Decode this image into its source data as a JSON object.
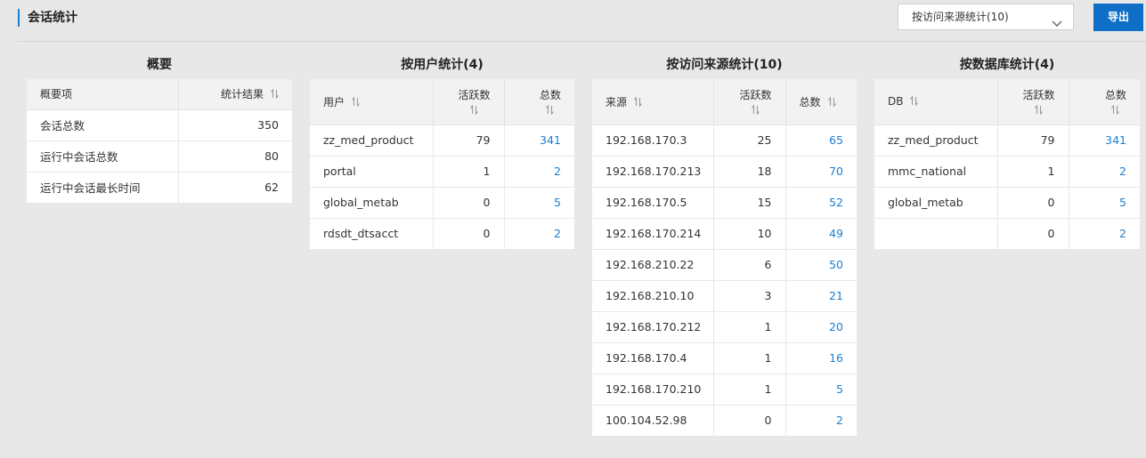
{
  "header": {
    "title": "会话统计",
    "select_value": "按访问来源统计(10)",
    "export_label": "导出"
  },
  "colors": {
    "accent": "#0f6fc6",
    "link": "#1b7fd1"
  },
  "overview": {
    "title": "概要",
    "columns": [
      "概要项",
      "统计结果"
    ],
    "rows": [
      [
        "会话总数",
        "350"
      ],
      [
        "运行中会话总数",
        "80"
      ],
      [
        "运行中会话最长时间",
        "62"
      ]
    ]
  },
  "by_user": {
    "title": "按用户统计(4)",
    "columns": [
      "用户",
      "活跃数",
      "总数"
    ],
    "rows": [
      [
        "zz_med_product",
        "79",
        "341"
      ],
      [
        "portal",
        "1",
        "2"
      ],
      [
        "global_metab",
        "0",
        "5"
      ],
      [
        "rdsdt_dtsacct",
        "0",
        "2"
      ]
    ]
  },
  "by_source": {
    "title": "按访问来源统计(10)",
    "columns": [
      "来源",
      "活跃数",
      "总数"
    ],
    "rows": [
      [
        "192.168.170.3",
        "25",
        "65"
      ],
      [
        "192.168.170.213",
        "18",
        "70"
      ],
      [
        "192.168.170.5",
        "15",
        "52"
      ],
      [
        "192.168.170.214",
        "10",
        "49"
      ],
      [
        "192.168.210.22",
        "6",
        "50"
      ],
      [
        "192.168.210.10",
        "3",
        "21"
      ],
      [
        "192.168.170.212",
        "1",
        "20"
      ],
      [
        "192.168.170.4",
        "1",
        "16"
      ],
      [
        "192.168.170.210",
        "1",
        "5"
      ],
      [
        "100.104.52.98",
        "0",
        "2"
      ]
    ]
  },
  "by_db": {
    "title": "按数据库统计(4)",
    "columns": [
      "DB",
      "活跃数",
      "总数"
    ],
    "rows": [
      [
        "zz_med_product",
        "79",
        "341"
      ],
      [
        "mmc_national",
        "1",
        "2"
      ],
      [
        "global_metab",
        "0",
        "5"
      ],
      [
        "",
        "0",
        "2"
      ]
    ]
  }
}
